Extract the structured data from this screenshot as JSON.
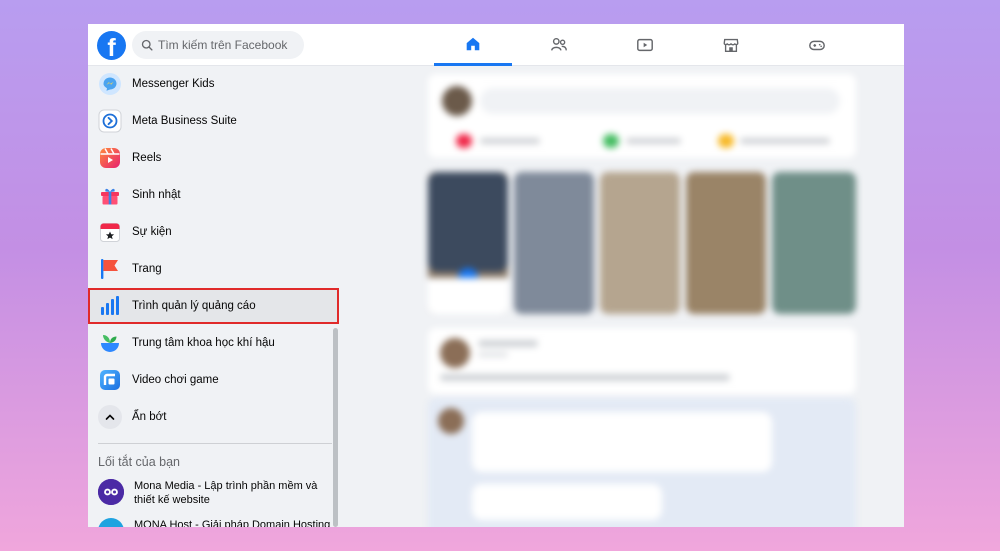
{
  "search": {
    "placeholder": "Tìm kiếm trên Facebook"
  },
  "topnav": {
    "tabs": [
      {
        "icon": "home-icon",
        "active": true
      },
      {
        "icon": "friends-icon",
        "active": false
      },
      {
        "icon": "watch-icon",
        "active": false
      },
      {
        "icon": "marketplace-icon",
        "active": false
      },
      {
        "icon": "gaming-icon",
        "active": false
      }
    ]
  },
  "sidebar": {
    "items": [
      {
        "label": "Messenger Kids",
        "icon": "messenger-kids-icon"
      },
      {
        "label": "Meta Business Suite",
        "icon": "business-suite-icon"
      },
      {
        "label": "Reels",
        "icon": "reels-icon"
      },
      {
        "label": "Sinh nhật",
        "icon": "birthday-gift-icon"
      },
      {
        "label": "Sự kiện",
        "icon": "calendar-icon"
      },
      {
        "label": "Trang",
        "icon": "flag-icon"
      },
      {
        "label": "Trình quản lý quảng cáo",
        "icon": "ads-manager-bar-chart-icon",
        "highlighted": true
      },
      {
        "label": "Trung tâm khoa học khí hậu",
        "icon": "climate-science-icon"
      },
      {
        "label": "Video chơi game",
        "icon": "gaming-video-icon"
      },
      {
        "label": "Ẩn bớt",
        "icon": "chevron-up-icon"
      }
    ],
    "shortcuts_title": "Lối tắt của bạn",
    "shortcuts": [
      {
        "label_line1": "Mona Media - Lập trình phần mềm và",
        "label_line2": "thiết kế website"
      },
      {
        "label_line1": "MONA Host - Giải pháp Domain Hosting",
        "label_line2": ""
      }
    ]
  },
  "colors": {
    "brand": "#1877f2",
    "highlight_border": "#e02a2a",
    "page_bg": "#f0f2f5"
  }
}
